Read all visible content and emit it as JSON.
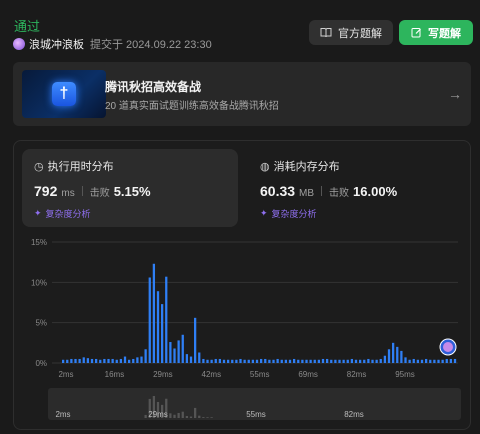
{
  "header": {
    "status": "通过",
    "username": "浪城冲浪板",
    "submit_time": "提交于 2024.09.22 23:30",
    "official_solution_label": "官方题解",
    "write_solution_label": "写题解"
  },
  "promo": {
    "title": "腾讯秋招高效备战",
    "subtitle": "20 道真实面试题训练高效备战腾讯秋招",
    "logo_glyph": "†",
    "arrow_icon": "arrow-right-icon"
  },
  "runtime": {
    "title": "执行用时分布",
    "value": "792",
    "unit": "ms",
    "beat_label": "击败",
    "beat": "5.15%",
    "analysis": "复杂度分析"
  },
  "memory": {
    "title": "消耗内存分布",
    "value": "60.33",
    "unit": "MB",
    "beat_label": "击败",
    "beat": "16.00%",
    "analysis": "复杂度分析"
  },
  "colors": {
    "accent_green": "#2db55d",
    "bar_blue": "#2f7ff5",
    "analysis_purple": "#8f6ff0"
  },
  "chart_data": {
    "type": "bar",
    "title": "",
    "xlabel": "",
    "ylabel": "",
    "ylim": [
      0,
      15
    ],
    "y_ticks": [
      "15%",
      "10%",
      "5%",
      "0%"
    ],
    "y_tick_values": [
      15,
      10,
      5,
      0
    ],
    "x_ticks": [
      "2ms",
      "16ms",
      "29ms",
      "42ms",
      "55ms",
      "69ms",
      "82ms",
      "95ms"
    ],
    "grid": true,
    "values": [
      0.4,
      0.4,
      0.5,
      0.5,
      0.5,
      0.7,
      0.6,
      0.5,
      0.5,
      0.4,
      0.5,
      0.5,
      0.5,
      0.4,
      0.5,
      0.8,
      0.4,
      0.5,
      0.7,
      0.8,
      1.7,
      10.6,
      12.3,
      8.9,
      7.3,
      10.7,
      2.6,
      1.8,
      2.8,
      3.5,
      1.1,
      0.8,
      5.6,
      1.3,
      0.5,
      0.4,
      0.4,
      0.5,
      0.5,
      0.4,
      0.4,
      0.4,
      0.4,
      0.5,
      0.4,
      0.4,
      0.4,
      0.4,
      0.5,
      0.5,
      0.4,
      0.4,
      0.5,
      0.4,
      0.4,
      0.4,
      0.5,
      0.4,
      0.4,
      0.4,
      0.4,
      0.4,
      0.4,
      0.5,
      0.5,
      0.4,
      0.4,
      0.4,
      0.4,
      0.4,
      0.5,
      0.4,
      0.4,
      0.4,
      0.5,
      0.4,
      0.4,
      0.5,
      0.9,
      1.7,
      2.5,
      2.0,
      1.5,
      0.7,
      0.4,
      0.5,
      0.4,
      0.4,
      0.5,
      0.4,
      0.4,
      0.4,
      0.4,
      0.5,
      0.5,
      0.5
    ],
    "highlight_marker": "user-avatar-marker"
  },
  "navigator": {
    "x_ticks": [
      "2ms",
      "29ms",
      "55ms",
      "82ms"
    ]
  }
}
